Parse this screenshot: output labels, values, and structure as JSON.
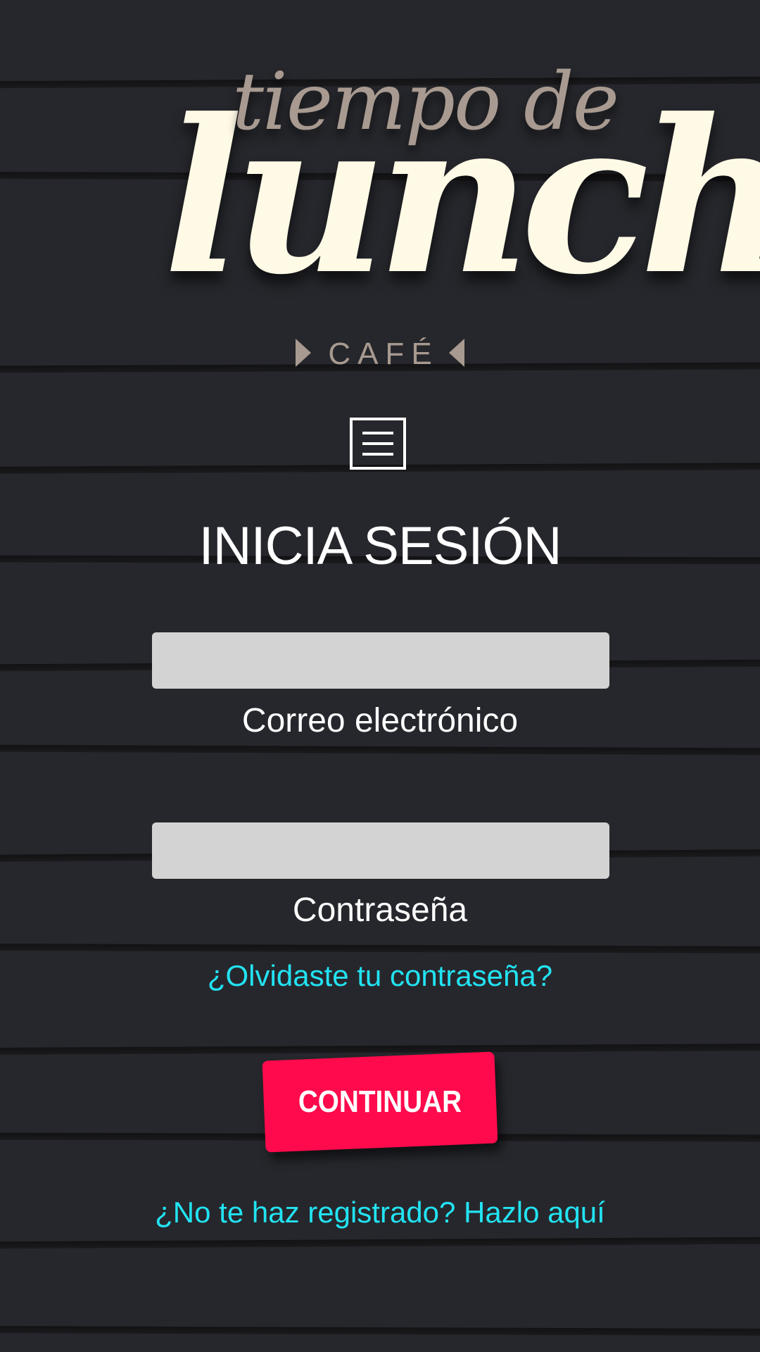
{
  "logo": {
    "line1": "tiempo de",
    "line2": "lunch",
    "sub": "CAFÉ"
  },
  "menu": {
    "icon": "menu-icon"
  },
  "heading": "INICIA SESIÓN",
  "form": {
    "email_label": "Correo electrónico",
    "email_value": "",
    "password_label": "Contraseña",
    "password_value": "",
    "forgot_link": "¿Olvidaste tu contraseña?",
    "continue_label": "CONTINUAR",
    "register_link": "¿No te haz registrado? Hazlo aquí"
  },
  "colors": {
    "background": "#26272c",
    "logo_cream": "#fefae6",
    "logo_taupe": "#a89a90",
    "link_cyan": "#22e3f2",
    "button_red": "#ff0a4c",
    "field_gray": "#d3d3d3"
  }
}
